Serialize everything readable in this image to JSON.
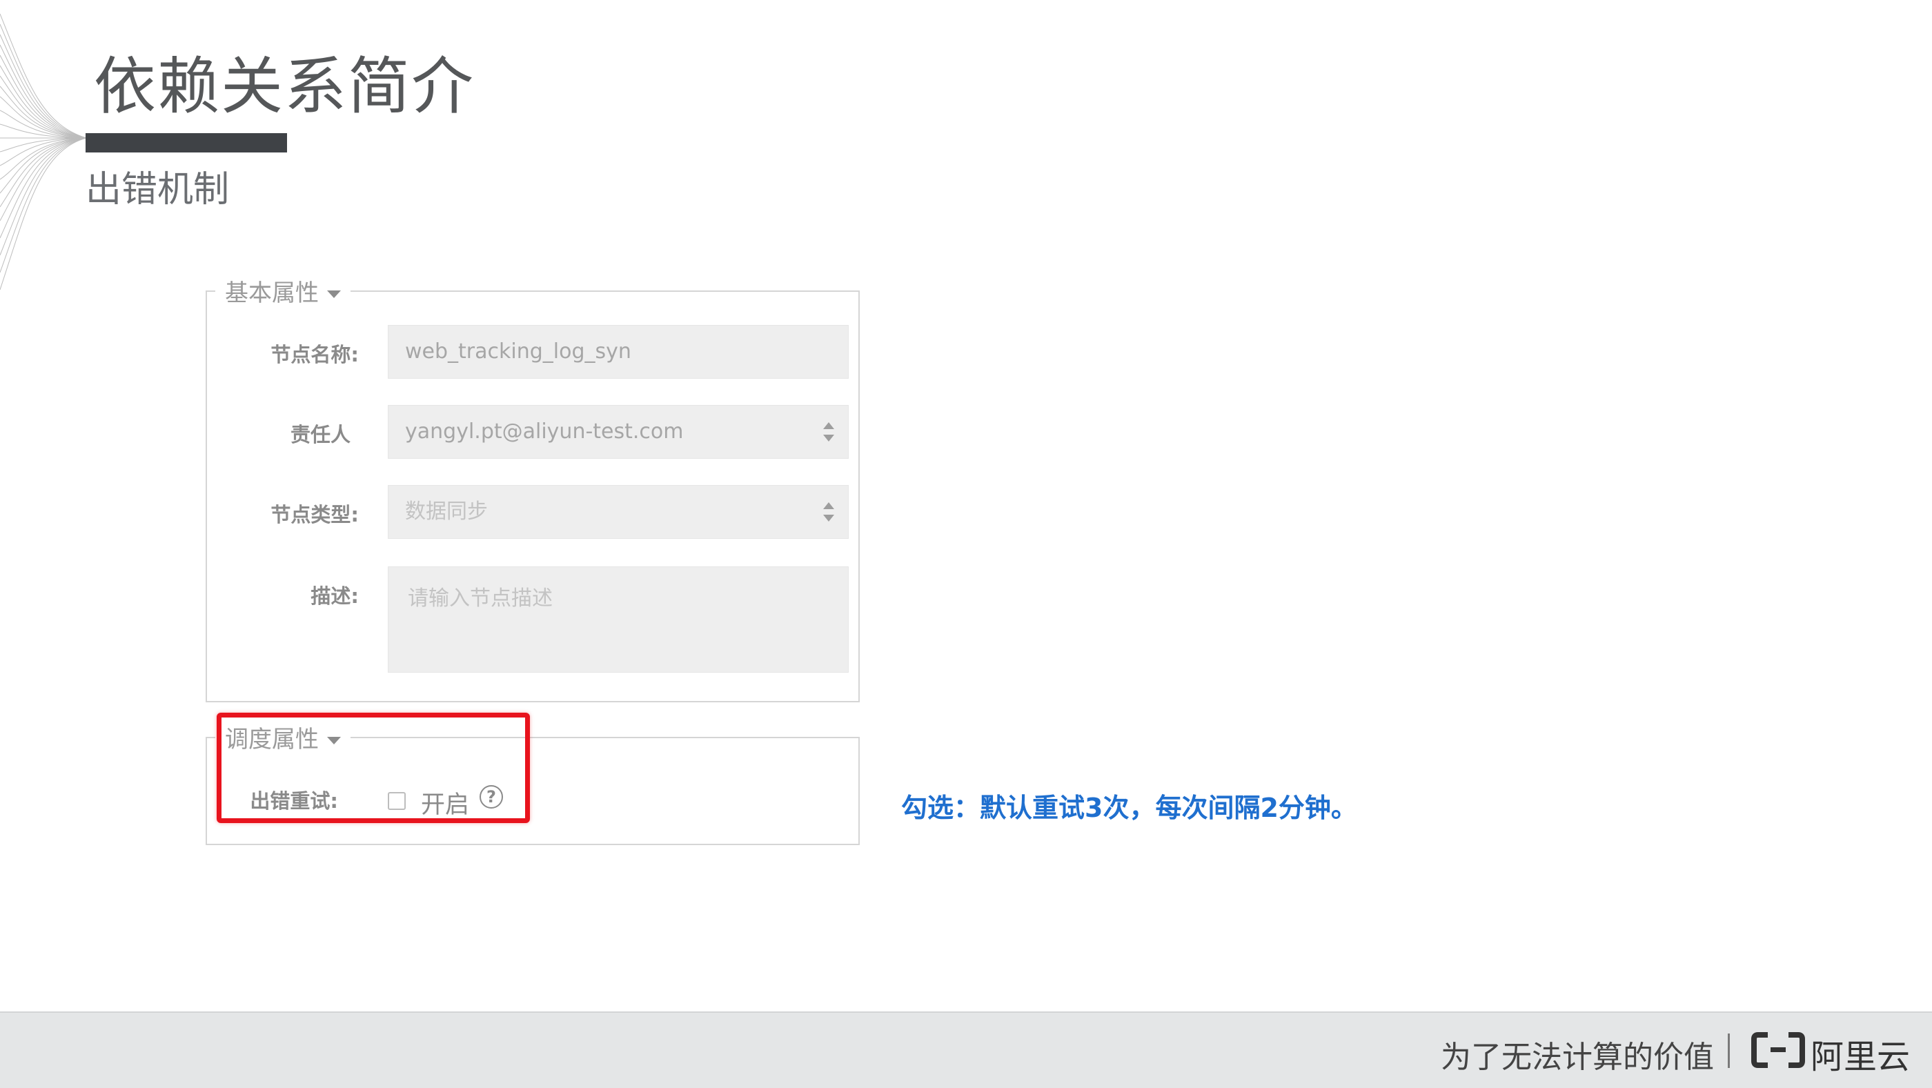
{
  "slide": {
    "title": "依赖关系简介",
    "subtitle": "出错机制"
  },
  "form": {
    "basic": {
      "legend": "基本属性",
      "fields": [
        {
          "label": "节点名称:",
          "value": "web_tracking_log_syn"
        },
        {
          "label": "责任人",
          "value": "yangyl.pt@aliyun-test.com"
        },
        {
          "label": "节点类型:",
          "value": "数据同步"
        },
        {
          "label": "描述:",
          "placeholder": "请输入节点描述"
        }
      ]
    },
    "schedule": {
      "legend": "调度属性",
      "retry_label": "出错重试:",
      "checkbox_label": "开启",
      "help_symbol": "?",
      "checked": false
    }
  },
  "note": "勾选：默认重试3次，每次间隔2分钟。",
  "footer": {
    "slogan": "为了无法计算的价值",
    "logo_text": "阿里云",
    "logo_icon": "aliyun-bracket-logo-icon"
  },
  "colors": {
    "title": "#555759",
    "highlight": "#e8131d",
    "note": "#1f6fcf",
    "footer_bg": "#e4e6e7"
  }
}
